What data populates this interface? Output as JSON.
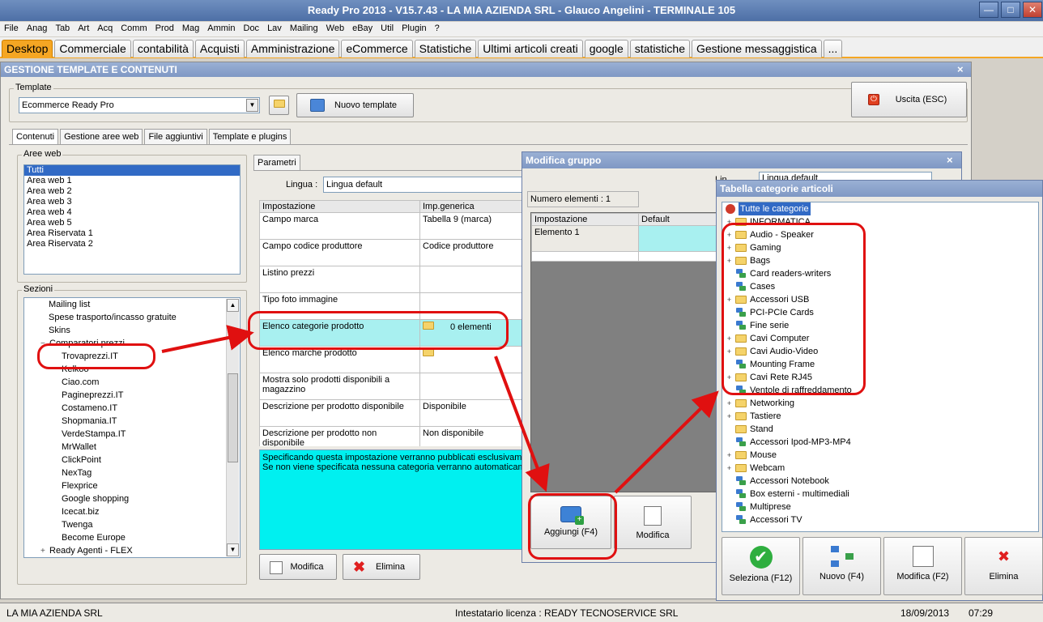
{
  "window": {
    "title": "Ready Pro 2013 - V15.7.43 - LA MIA AZIENDA SRL - Glauco Angelini - TERMINALE 105"
  },
  "menu": [
    "File",
    "Anag",
    "Tab",
    "Art",
    "Acq",
    "Comm",
    "Prod",
    "Mag",
    "Ammin",
    "Doc",
    "Lav",
    "Mailing",
    "Web",
    "eBay",
    "Util",
    "Plugin",
    "?"
  ],
  "tabs": [
    "Desktop",
    "Commerciale",
    "contabilità",
    "Acquisti",
    "Amministrazione",
    "eCommerce",
    "Statistiche",
    "Ultimi articoli creati",
    "google",
    "statistiche",
    "Gestione messaggistica",
    "..."
  ],
  "panel": {
    "title": "GESTIONE TEMPLATE E CONTENUTI",
    "close": "×"
  },
  "template": {
    "group_label": "Template",
    "selected": "Ecommerce Ready Pro",
    "new_button": "Nuovo template",
    "exit_button": "Uscita (ESC)"
  },
  "subtabs": [
    "Contenuti",
    "Gestione aree web",
    "File aggiuntivi",
    "Template e plugins"
  ],
  "aree_web": {
    "label": "Aree web",
    "items": [
      "Tutti",
      "Area web 1",
      "Area web 2",
      "Area web 3",
      "Area web 4",
      "Area web 5",
      "Area Riservata 1",
      "Area Riservata 2"
    ]
  },
  "sezioni": {
    "label": "Sezioni",
    "items": [
      "Mailing list",
      "Spese trasporto/incasso gratuite",
      "Skins",
      "Comparatori prezzi",
      "Trovaprezzi.IT",
      "Kelkoo",
      "Ciao.com",
      "Pagineprezzi.IT",
      "Costameno.IT",
      "Shopmania.IT",
      "VerdeStampa.IT",
      "MrWallet",
      "ClickPoint",
      "NexTag",
      "Flexprice",
      "Google shopping",
      "Icecat.biz",
      "Twenga",
      "Become Europe",
      "Ready Agenti - FLEX"
    ]
  },
  "parametri": {
    "tab": "Parametri",
    "lingua_label": "Lingua :",
    "lingua_value": "Lingua default",
    "headers": [
      "Impostazione",
      "Imp.generica"
    ],
    "rows": [
      [
        "Campo marca",
        "Tabella 9 (marca)"
      ],
      [
        "Campo codice produttore",
        "Codice produttore"
      ],
      [
        "Listino prezzi",
        ""
      ],
      [
        "Tipo foto immagine",
        ""
      ],
      [
        "Elenco categorie prodotto",
        "0 elementi"
      ],
      [
        "Elenco marche prodotto",
        ""
      ],
      [
        "Mostra solo prodotti disponibili a magazzino",
        ""
      ],
      [
        "Descrizione per prodotto disponibile",
        "Disponibile"
      ],
      [
        "Descrizione per prodotto non disponibile",
        "Non disponibile"
      ]
    ],
    "note": "Specificando questa impostazione verranno pubblicati esclusivamen\nSe non viene specificata nessuna categoria verranno automaticame",
    "modifica": "Modifica",
    "elimina": "Elimina"
  },
  "gruppo": {
    "title": "Modifica gruppo",
    "close": "×",
    "count_label": "Numero elementi : 1",
    "lingua_label": "Lin",
    "lingua_value": "Lingua default",
    "headers": [
      "Impostazione",
      "Default"
    ],
    "rows": [
      [
        "Elemento 1",
        ""
      ]
    ],
    "add": "Aggiungi (F4)",
    "edit": "Modifica"
  },
  "categorie": {
    "title": "Tabella categorie articoli",
    "root": "Tutte le categorie",
    "items": [
      [
        "INFORMATICA",
        "folder",
        true
      ],
      [
        "Audio - Speaker",
        "folder",
        true
      ],
      [
        "Gaming",
        "folder",
        true
      ],
      [
        "Bags",
        "folder",
        true
      ],
      [
        "Card readers-writers",
        "net",
        false
      ],
      [
        "Cases",
        "net",
        false
      ],
      [
        "Accessori USB",
        "folder",
        true
      ],
      [
        "PCI-PCIe Cards",
        "net",
        false
      ],
      [
        "Fine serie",
        "net",
        false
      ],
      [
        "Cavi Computer",
        "folder",
        true
      ],
      [
        "Cavi Audio-Video",
        "folder",
        true
      ],
      [
        "Mounting Frame",
        "net",
        false
      ],
      [
        "Cavi Rete RJ45",
        "folder",
        true
      ],
      [
        "Ventole di raffreddamento",
        "net",
        false
      ],
      [
        "Networking",
        "folder",
        true
      ],
      [
        "Tastiere",
        "folder",
        true
      ],
      [
        "Stand",
        "folder",
        false
      ],
      [
        "Accessori Ipod-MP3-MP4",
        "net",
        false
      ],
      [
        "Mouse",
        "folder",
        true
      ],
      [
        "Webcam",
        "folder",
        true
      ],
      [
        "Accessori Notebook",
        "net",
        false
      ],
      [
        "Box esterni - multimediali",
        "net",
        false
      ],
      [
        "Multiprese",
        "net",
        false
      ],
      [
        "Accessori TV",
        "net",
        false
      ]
    ],
    "buttons": [
      "Seleziona (F12)",
      "Nuovo (F4)",
      "Modifica (F2)",
      "Elimina"
    ]
  },
  "status": {
    "company": "LA MIA AZIENDA SRL",
    "license": "Intestatario licenza : READY TECNOSERVICE SRL",
    "date": "18/09/2013",
    "time": "07:29"
  }
}
